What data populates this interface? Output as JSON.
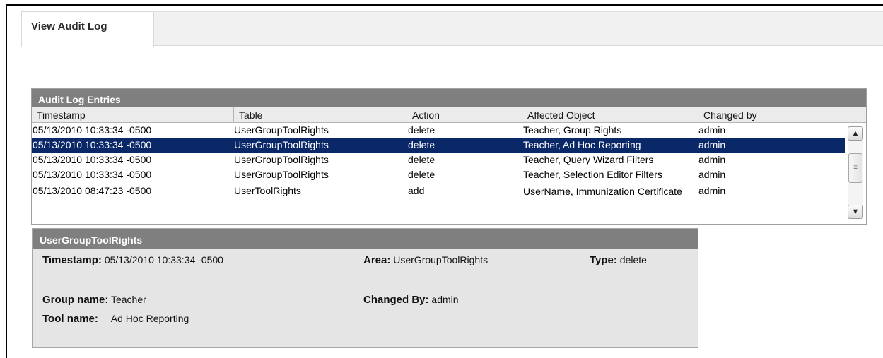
{
  "tabs": [
    {
      "label": "View Audit Log",
      "active": true
    }
  ],
  "entries": {
    "title": "Audit Log Entries",
    "columns": [
      "Timestamp",
      "Table",
      "Action",
      "Affected Object",
      "Changed by"
    ],
    "rows": [
      {
        "timestamp": "05/13/2010 10:33:34 -0500",
        "table": "UserGroupToolRights",
        "action": "delete",
        "object": "Teacher, Group Rights",
        "changed_by": "admin"
      },
      {
        "timestamp": "05/13/2010 10:33:34 -0500",
        "table": "UserGroupToolRights",
        "action": "delete",
        "object": "Teacher, Ad Hoc Reporting",
        "changed_by": "admin",
        "selected": true
      },
      {
        "timestamp": "05/13/2010 10:33:34 -0500",
        "table": "UserGroupToolRights",
        "action": "delete",
        "object": "Teacher, Query Wizard Filters",
        "changed_by": "admin"
      },
      {
        "timestamp": "05/13/2010 10:33:34 -0500",
        "table": "UserGroupToolRights",
        "action": "delete",
        "object": "Teacher, Selection Editor Filters",
        "changed_by": "admin"
      },
      {
        "timestamp": "05/13/2010 08:47:23 -0500",
        "table": "UserToolRights",
        "action": "add",
        "object": "UserName, Immunization Certificate",
        "changed_by": "admin"
      }
    ]
  },
  "detail": {
    "title": "UserGroupToolRights",
    "timestamp_label": "Timestamp:",
    "timestamp_value": "05/13/2010 10:33:34 -0500",
    "area_label": "Area:",
    "area_value": "UserGroupToolRights",
    "type_label": "Type:",
    "type_value": "delete",
    "group_label": "Group name:",
    "group_value": "Teacher",
    "changed_label": "Changed By:",
    "changed_value": "admin",
    "tool_label": "Tool name:",
    "tool_value": "Ad Hoc Reporting"
  },
  "scrollbar": {
    "up_icon": "▲",
    "down_icon": "▼",
    "grip_icon": "≡"
  },
  "colors": {
    "selection": "#0a2768",
    "header_bar": "#7f7f7f",
    "detail_bg": "#e5e5e5"
  }
}
